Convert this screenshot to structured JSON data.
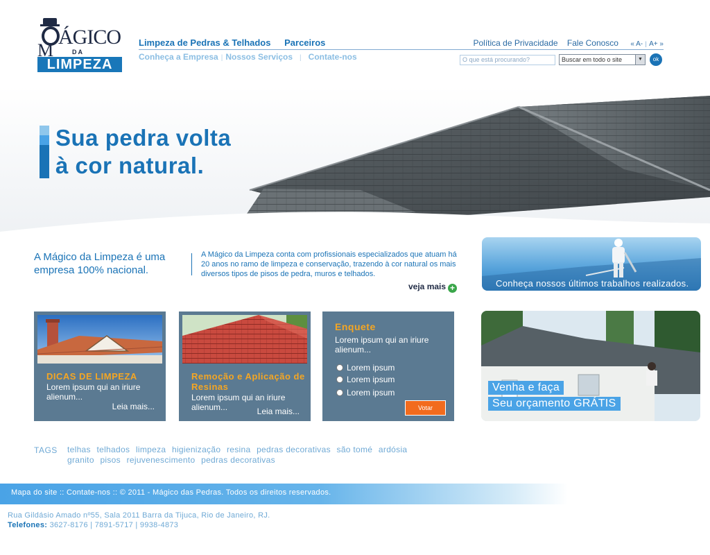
{
  "logo": {
    "top": "ÁGICO",
    "m": "M",
    "da": "DA",
    "limpeza": "LIMPEZA"
  },
  "nav": {
    "primary": [
      "Limpeza de Pedras & Telhados",
      "Parceiros"
    ],
    "secondary": [
      "Conheça a Empresa",
      "Nossos Serviços",
      "Contate-nos"
    ],
    "separator": "|"
  },
  "util": {
    "privacy": "Política de Privacidade",
    "contact": "Fale Conosco",
    "font_down": "« A-",
    "font_sep": "|",
    "font_up": "A+ »"
  },
  "search": {
    "placeholder": "O que está procurando?",
    "scope": "Buscar em todo o site",
    "submit": "ok"
  },
  "hero": {
    "line1": "Sua pedra volta",
    "line2": "à cor natural."
  },
  "intro": {
    "headline": "A Mágico da Limpeza é uma empresa 100% nacional.",
    "body": "A Mágico da Limpeza conta com profissionais especializados que atuam há 20 anos no ramo de limpeza e conservação, trazendo à cor natural os mais diversos tipos de pisos de pedra, muros e telhados.",
    "more": "veja mais",
    "more_icon": "+"
  },
  "promo_works": {
    "caption": "Conheça nossos últimos trabalhos realizados."
  },
  "cards": [
    {
      "title": "DICAS DE LIMPEZA",
      "text": "Lorem ipsum qui an iriure alienum...",
      "more": "Leia mais..."
    },
    {
      "title": "Remoção e Aplicação de Resinas",
      "text": "Lorem ipsum qui an iriure alienum...",
      "more": "Leia mais..."
    }
  ],
  "poll": {
    "title": "Enquete",
    "question": "Lorem ipsum qui an iriure alienum...",
    "options": [
      "Lorem ipsum",
      "Lorem ipsum",
      "Lorem ipsum"
    ],
    "submit": "Votar"
  },
  "promo_quote": {
    "line1": "Venha e faça",
    "line2": "Seu orçamento GRÁTIS"
  },
  "tags": {
    "label": "TAGS",
    "items": [
      "telhas",
      "telhados",
      "limpeza",
      "higienização",
      "resina",
      "pedras decorativas",
      "são tomé",
      "ardósia",
      "granito",
      "pisos",
      "rejuvenescimento",
      "pedras decorativas"
    ]
  },
  "footer": {
    "sitemap": "Mapa do site",
    "sep": "::",
    "contact": "Contate-nos",
    "copyright": "© 2011 - Mágico das Pedras. Todos os direitos reservados.",
    "address": "Rua Gildásio Amado nº55, Sala 2011 Barra da Tijuca, Rio de Janeiro, RJ.",
    "phones_label": "Telefones:",
    "phones": "3627-8176 | 7891-5717 | 9938-4873"
  },
  "colors": {
    "brand_blue": "#1a73b6",
    "card_bg": "#5b7a92",
    "accent_orange": "#f5a623",
    "vote_orange": "#f26b1d"
  }
}
